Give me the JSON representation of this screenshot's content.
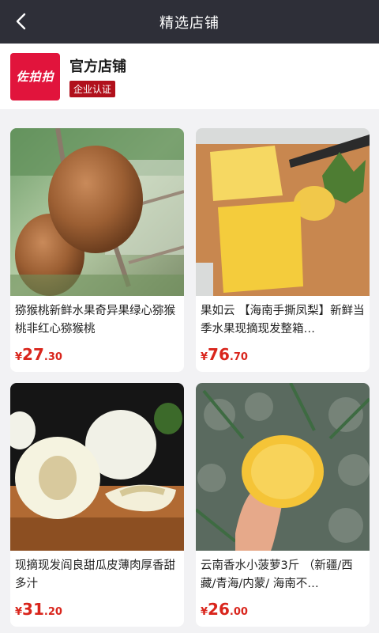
{
  "header": {
    "title": "精选店铺",
    "back_icon": "chevron-left-icon"
  },
  "shop": {
    "logo_text": "佐拍拍",
    "name": "官方店铺",
    "badge": "企业认证"
  },
  "products": [
    {
      "title": "猕猴桃新鲜水果奇异果绿心猕猴桃非红心猕猴桃",
      "currency": "¥",
      "price_int": "27",
      "price_dec": ".30",
      "image": "kiwi-photo"
    },
    {
      "title": "果如云 【海南手撕凤梨】新鲜当季水果现摘现发整箱…",
      "currency": "¥",
      "price_int": "76",
      "price_dec": ".70",
      "image": "pineapple-cut-photo"
    },
    {
      "title": "现摘现发阎良甜瓜皮薄肉厚香甜多汁",
      "currency": "¥",
      "price_int": "31",
      "price_dec": ".20",
      "image": "melon-photo"
    },
    {
      "title": "云南香水小菠萝3斤 （新疆/西藏/青海/内蒙/ 海南不…",
      "currency": "¥",
      "price_int": "26",
      "price_dec": ".00",
      "image": "small-pineapple-photo"
    }
  ],
  "colors": {
    "topbar": "#2e2f38",
    "price": "#d9251c",
    "badge": "#b1101c",
    "logo": "#e1143c"
  }
}
